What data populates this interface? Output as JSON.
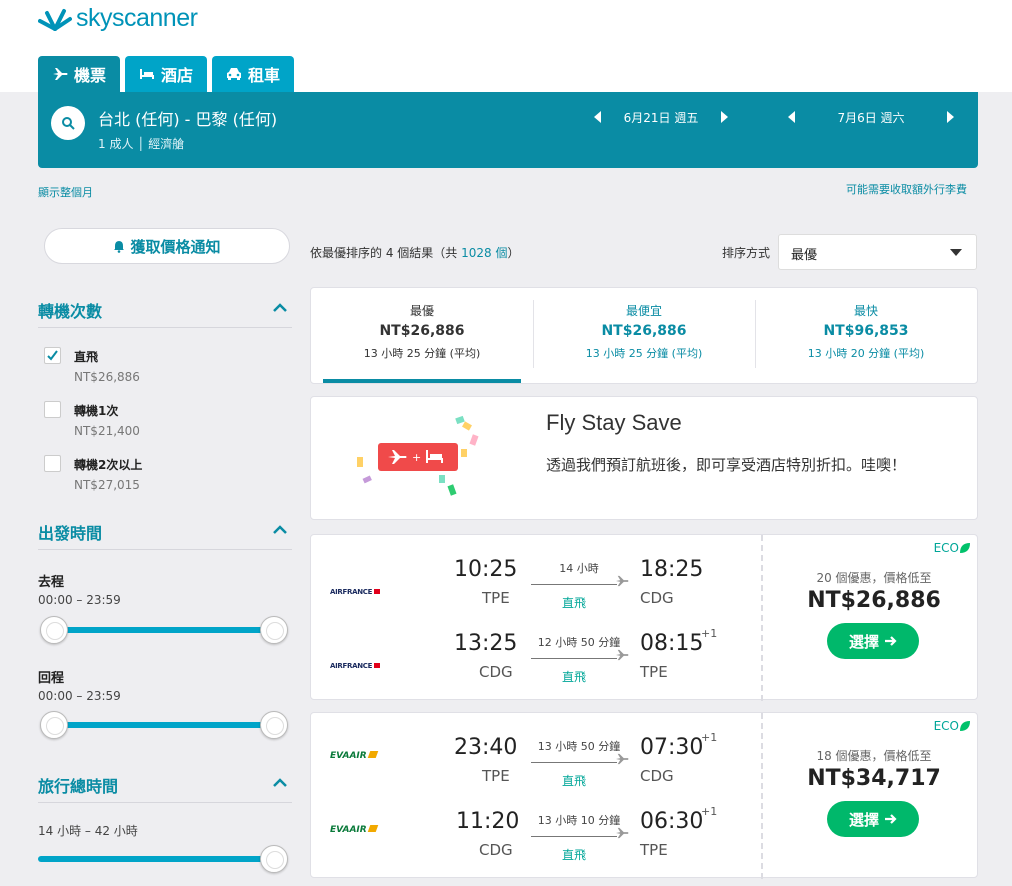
{
  "brand": {
    "name": "skyscanner",
    "color": "#0093b8"
  },
  "tabs": [
    {
      "label": "機票",
      "icon": "plane-icon",
      "active": true
    },
    {
      "label": "酒店",
      "icon": "bed-icon"
    },
    {
      "label": "租車",
      "icon": "car-icon"
    }
  ],
  "search": {
    "route": "台北 (任何) - 巴黎 (任何)",
    "passengers": "1 成人 │ 經濟艙",
    "depart_date": "6月21日 週五",
    "return_date": "7月6日 週六"
  },
  "links": {
    "show_month": "顯示整個月",
    "extra_fees": "可能需要收取額外行李費"
  },
  "sidebar": {
    "alert_button": "獲取價格通知",
    "stops": {
      "title": "轉機次數",
      "options": [
        {
          "label": "直飛",
          "price": "NT$26,886",
          "checked": true
        },
        {
          "label": "轉機1次",
          "price": "NT$21,400",
          "checked": false
        },
        {
          "label": "轉機2次以上",
          "price": "NT$27,015",
          "checked": false
        }
      ]
    },
    "times": {
      "title": "出發時間",
      "outbound_label": "去程",
      "outbound_range": "00:00 – 23:59",
      "return_label": "回程",
      "return_range": "00:00 – 23:59"
    },
    "duration": {
      "title": "旅行總時間",
      "range": "14 小時 – 42 小時"
    }
  },
  "results": {
    "summary_prefix": "依最優排序的 4 個結果（共 ",
    "summary_count": "1028 個",
    "summary_suffix": "）",
    "sort_label": "排序方式",
    "sort_value": "最優"
  },
  "sort_cards": [
    {
      "title": "最優",
      "price": "NT$26,886",
      "duration": "13 小時 25 分鐘 (平均)"
    },
    {
      "title": "最便宜",
      "price": "NT$26,886",
      "duration": "13 小時 25 分鐘 (平均)"
    },
    {
      "title": "最快",
      "price": "NT$96,853",
      "duration": "13 小時 20 分鐘 (平均)"
    }
  ],
  "promo": {
    "title": "Fly Stay Save",
    "text": "透過我們預訂航班後，即可享受酒店特別折扣。哇噢！"
  },
  "flights": [
    {
      "airline": "AIRFRANCE",
      "eco": "ECO",
      "deals": "20 個優惠，價格低至",
      "price": "NT$26,886",
      "select": "選擇",
      "legs": [
        {
          "dep": "10:25",
          "dep_code": "TPE",
          "arr": "18:25",
          "arr_code": "CDG",
          "duration": "14 小時",
          "stops": "直飛",
          "plus": ""
        },
        {
          "dep": "13:25",
          "dep_code": "CDG",
          "arr": "08:15",
          "arr_code": "TPE",
          "duration": "12 小時 50 分鐘",
          "stops": "直飛",
          "plus": "+1"
        }
      ]
    },
    {
      "airline": "EVAAIR",
      "eco": "ECO",
      "deals": "18 個優惠，價格低至",
      "price": "NT$34,717",
      "select": "選擇",
      "legs": [
        {
          "dep": "23:40",
          "dep_code": "TPE",
          "arr": "07:30",
          "arr_code": "CDG",
          "duration": "13 小時 50 分鐘",
          "stops": "直飛",
          "plus": "+1"
        },
        {
          "dep": "11:20",
          "dep_code": "CDG",
          "arr": "06:30",
          "arr_code": "TPE",
          "duration": "13 小時 10 分鐘",
          "stops": "直飛",
          "plus": "+1"
        }
      ]
    }
  ],
  "colors": {
    "teal": "#0a8ca4",
    "green": "#00b86b",
    "eco": "#00a698"
  }
}
